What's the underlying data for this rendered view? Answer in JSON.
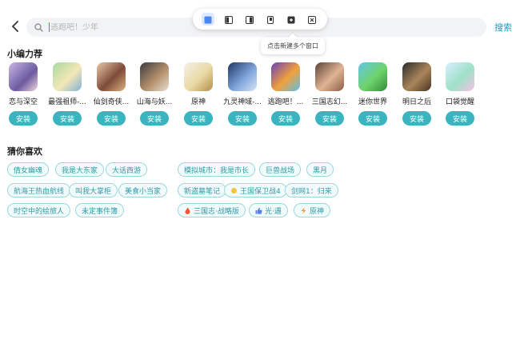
{
  "search": {
    "placeholder": "逃跑吧！少年",
    "submit_label": "搜索"
  },
  "window_toolbar": {
    "tooltip": "点击新建多个窗口"
  },
  "recommend": {
    "title": "小编力荐",
    "install_label": "安装",
    "games": [
      {
        "name": "恋与深空"
      },
      {
        "name": "最强祖师-..."
      },
      {
        "name": "仙剑奇侠..."
      },
      {
        "name": "山海与妖..."
      },
      {
        "name": "原神"
      },
      {
        "name": "九灵神域-..."
      },
      {
        "name": "逃跑吧！..."
      },
      {
        "name": "三国志幻..."
      },
      {
        "name": "迷你世界"
      },
      {
        "name": "明日之后"
      },
      {
        "name": "口袋觉醒"
      }
    ]
  },
  "guess": {
    "title": "猜你喜欢",
    "tags": [
      {
        "label": "倩女幽魂"
      },
      {
        "label": "我是大东家"
      },
      {
        "label": "大话西游"
      },
      {
        "label": "航海王热血航线"
      },
      {
        "label": "叫我大掌柜"
      },
      {
        "label": "美食小当家"
      },
      {
        "label": "时空中的绘旅人"
      },
      {
        "label": "未定事件簿"
      },
      {
        "label": "模拟城市：我是市长"
      },
      {
        "label": "巨兽战场"
      },
      {
        "label": "黑月"
      },
      {
        "label": "新盗墓笔记"
      },
      {
        "label": "王国保卫战4"
      },
      {
        "label": "剑网1：归来"
      },
      {
        "label": "三国志·战略版"
      },
      {
        "label": "光·遇"
      },
      {
        "label": "原神"
      }
    ]
  }
}
